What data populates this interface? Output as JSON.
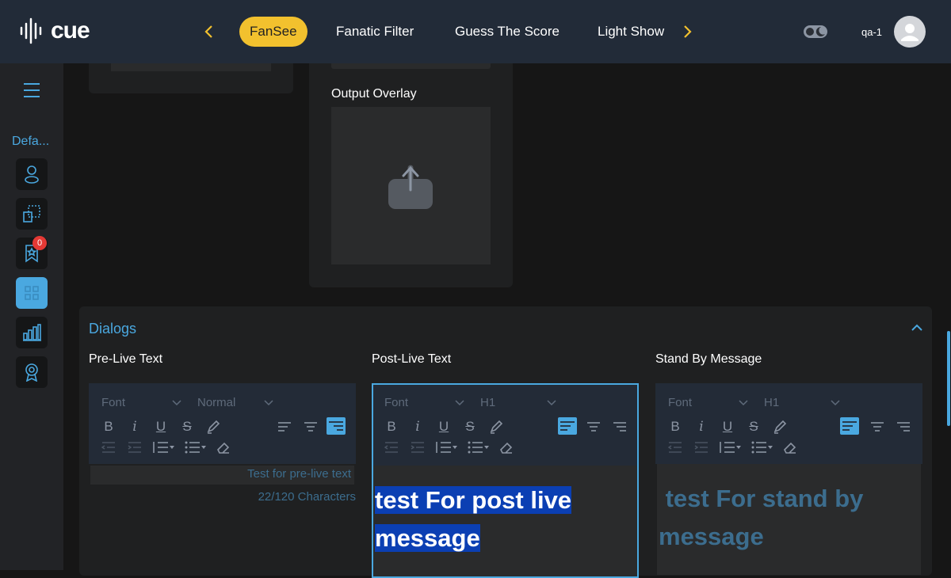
{
  "header": {
    "logo_text": "cue",
    "tabs": [
      {
        "label": "FanSee",
        "active": true
      },
      {
        "label": "Fanatic Filter",
        "active": false
      },
      {
        "label": "Guess The Score",
        "active": false
      },
      {
        "label": "Light Show",
        "active": false
      }
    ],
    "user_name": "qa-1"
  },
  "sidebar": {
    "section_label": "Defa...",
    "notification_count": "0"
  },
  "overlay": {
    "label": "Output Overlay"
  },
  "dialogs": {
    "title": "Dialogs",
    "columns": [
      {
        "label": "Pre-Live Text",
        "font": "Font",
        "size": "Normal",
        "text": "Test for pre-live text",
        "char_count": "22/120 Characters"
      },
      {
        "label": "Post-Live Text",
        "font": "Font",
        "size": "H1",
        "line1": "test For post live ",
        "line2": "message"
      },
      {
        "label": "Stand By Message",
        "font": "Font",
        "size": "H1",
        "line1": " test For stand by",
        "line2": "message"
      }
    ]
  },
  "colors": {
    "accent": "#4aa8e0",
    "tab_active": "#f2c12e",
    "header_bg": "#222b38",
    "badge": "#e53935",
    "selection": "#0b3fb3"
  }
}
